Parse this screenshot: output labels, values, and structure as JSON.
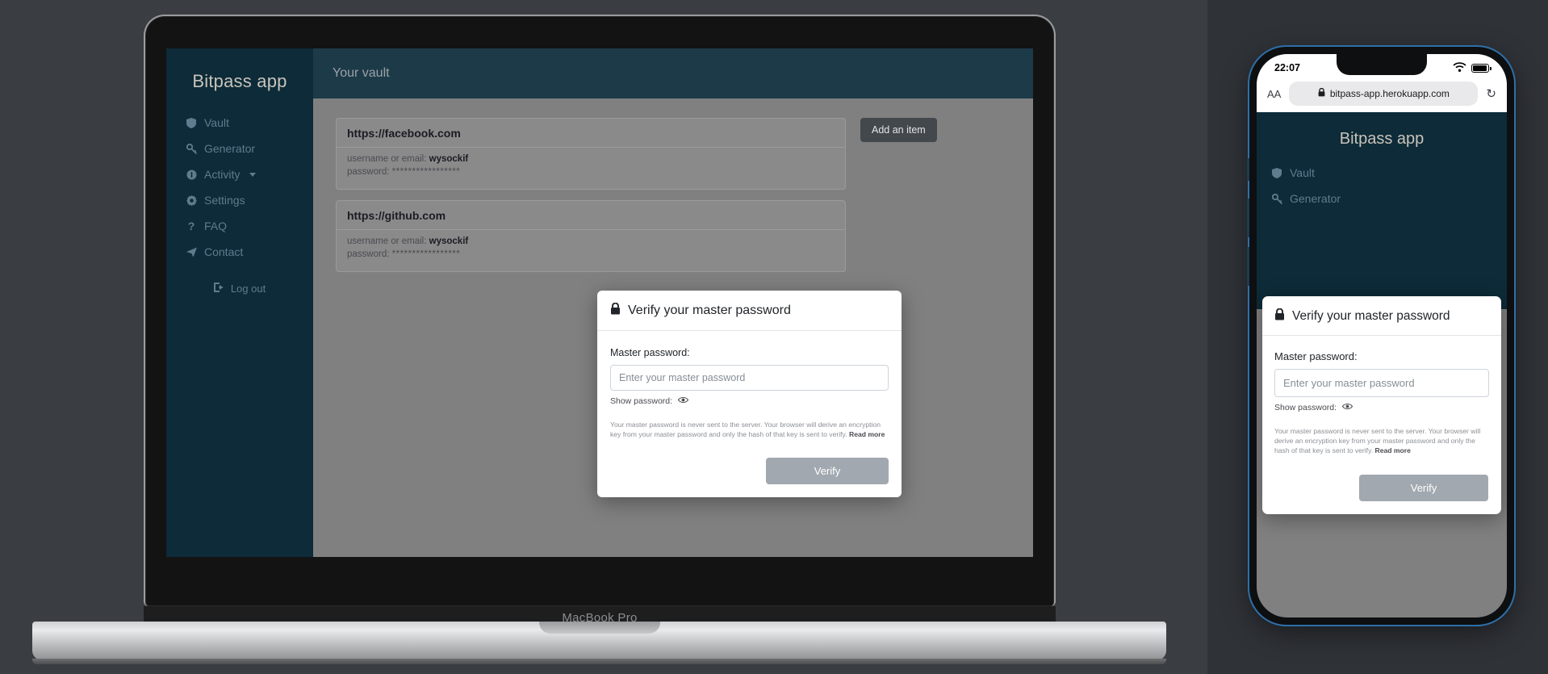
{
  "app": {
    "brand": "Bitpass app",
    "page_title": "Your vault",
    "nav": [
      {
        "label": "Vault",
        "icon": "shield-icon"
      },
      {
        "label": "Generator",
        "icon": "key-icon"
      },
      {
        "label": "Activity",
        "icon": "info-circle-icon",
        "has_caret": true
      },
      {
        "label": "Settings",
        "icon": "gear-icon"
      },
      {
        "label": "FAQ",
        "icon": "question-mark-icon"
      },
      {
        "label": "Contact",
        "icon": "paper-plane-icon"
      }
    ],
    "logout_label": "Log out",
    "add_item_label": "Add an item"
  },
  "vault": {
    "username_prefix": "username or email:",
    "password_prefix": "password:",
    "masked_password": "*****************",
    "items": [
      {
        "site": "https://facebook.com",
        "username": "wysockif"
      },
      {
        "site": "https://github.com",
        "username": "wysockif"
      }
    ]
  },
  "modal": {
    "icon": "lock-icon",
    "title": "Verify your master password",
    "field_label": "Master password:",
    "input_value": "",
    "input_placeholder": "Enter your master password",
    "show_password_label": "Show password:",
    "show_password_icon": "eye-icon",
    "note": "Your master password is never sent to the server. Your browser will derive an encryption key from your master password and only the hash of that key is sent to verify.",
    "note_link": "Read more",
    "submit_label": "Verify"
  },
  "laptop": {
    "model_label": "MacBook Pro"
  },
  "phone": {
    "status_time": "22:07",
    "wifi_icon": "wifi-icon",
    "battery_icon": "battery-icon",
    "aa_label": "AA",
    "lock_icon": "lock-icon",
    "url": "bitpass-app.herokuapp.com",
    "reload_icon": "reload-icon",
    "toolbar": [
      {
        "icon": "back-chevron-icon"
      },
      {
        "icon": "forward-chevron-icon"
      },
      {
        "icon": "share-icon"
      },
      {
        "icon": "bookmarks-icon"
      },
      {
        "icon": "tabs-icon"
      }
    ]
  },
  "colors": {
    "sidebar": "#0d2b38",
    "topbar": "#1d3a48",
    "page_bg": "#808080",
    "accent_text": "#5f7c8e",
    "brand_text": "#c9c3bb",
    "button_dark": "#43484d",
    "button_disabled": "#a2a8b0",
    "ios_blue": "#3478f6"
  }
}
